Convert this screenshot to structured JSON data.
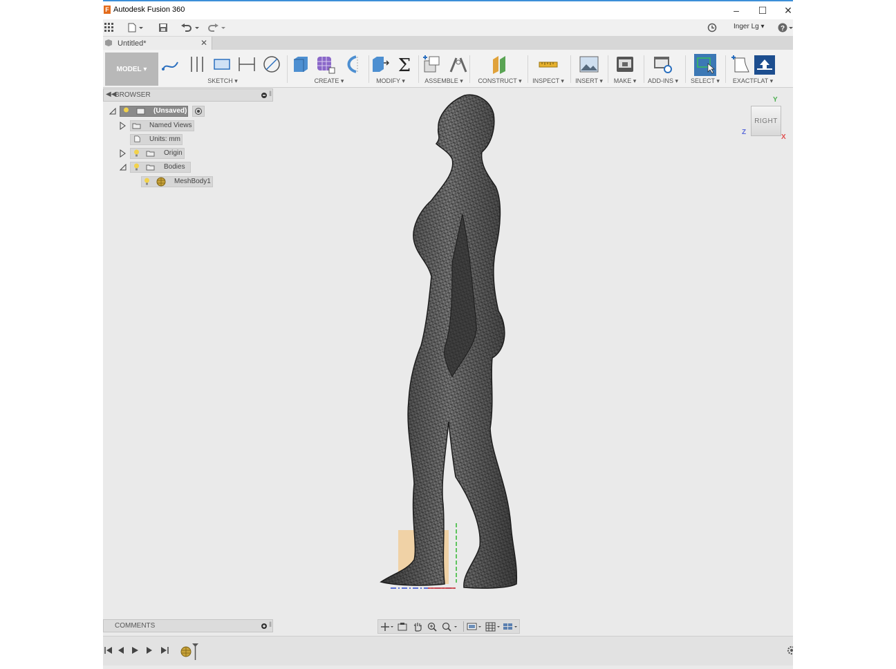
{
  "window": {
    "title": "Autodesk Fusion 360"
  },
  "qat": {
    "user": "Inger Lg"
  },
  "document_tab": {
    "label": "Untitled*"
  },
  "toolbar": {
    "workspace": "MODEL",
    "groups": [
      "SKETCH",
      "CREATE",
      "MODIFY",
      "ASSEMBLE",
      "CONSTRUCT",
      "INSPECT",
      "INSERT",
      "MAKE",
      "ADD-INS",
      "SELECT",
      "EXACTFLAT"
    ]
  },
  "browser": {
    "title": "BROWSER",
    "root": "(Unsaved)",
    "items": [
      "Named Views",
      "Units: mm",
      "Origin",
      "Bodies",
      "MeshBody1"
    ]
  },
  "viewcube": {
    "face": "RIGHT",
    "axes": [
      "Y",
      "Z",
      "X"
    ]
  },
  "comments": {
    "title": "COMMENTS"
  },
  "colors": {
    "accent": "#3c8fd8",
    "select_active": "#3c78b5",
    "mesh": "#4a4a4a",
    "plane": "#f2c98f"
  },
  "icons": [
    "grid-menu-icon",
    "file-icon",
    "save-icon",
    "undo-icon",
    "redo-icon",
    "history-icon",
    "help-icon",
    "bulb-icon",
    "folder-icon",
    "mesh-body-icon",
    "orbit-icon",
    "pan-icon",
    "zoom-icon",
    "display-icon",
    "grid-icon",
    "settings-icon"
  ]
}
